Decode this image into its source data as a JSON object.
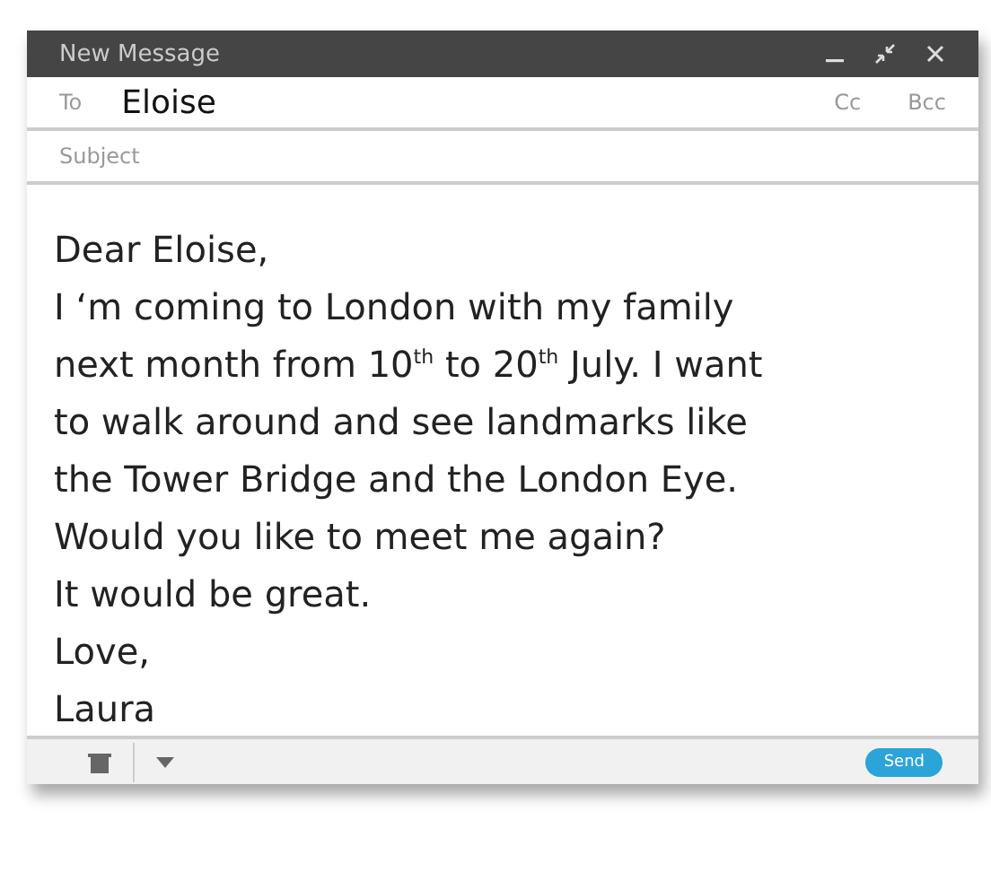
{
  "window": {
    "title": "New Message"
  },
  "to": {
    "label": "To",
    "value": "Eloise"
  },
  "cc": "Cc",
  "bcc": "Bcc",
  "subject": {
    "placeholder": "Subject"
  },
  "body": [
    "Dear Eloise,",
    "I ‘m coming to London with my family",
    "next month from 10$^{th}$ to 20$^{th}$ July. I want",
    "to walk around and see landmarks like",
    "the Tower Bridge and the London Eye.",
    "Would you like to meet me again?",
    "It would be great.",
    "Love,",
    "Laura"
  ],
  "send": "Send"
}
